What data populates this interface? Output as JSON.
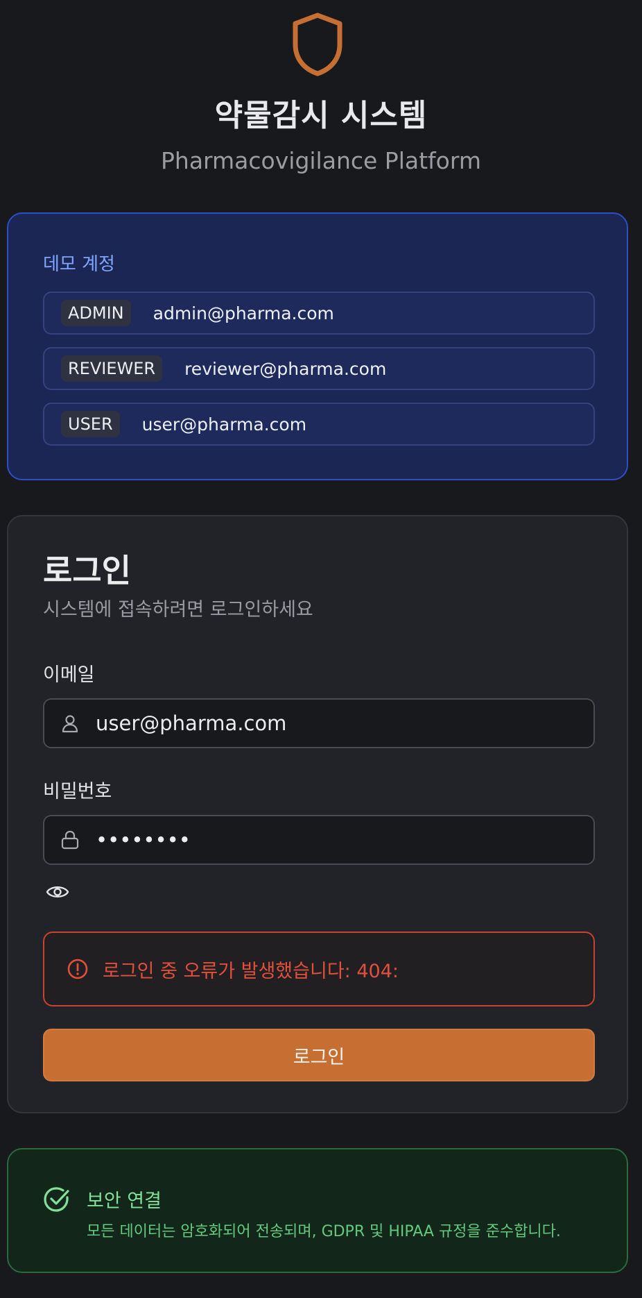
{
  "header": {
    "logo_icon": "shield-icon",
    "title": "약물감시 시스템",
    "subtitle": "Pharmacovigilance Platform"
  },
  "demo": {
    "title": "데모 계정",
    "accounts": [
      {
        "role": "ADMIN",
        "email": "admin@pharma.com"
      },
      {
        "role": "REVIEWER",
        "email": "reviewer@pharma.com"
      },
      {
        "role": "USER",
        "email": "user@pharma.com"
      }
    ]
  },
  "login": {
    "title": "로그인",
    "subtitle": "시스템에 접속하려면 로그인하세요",
    "email_label": "이메일",
    "email_value": "user@pharma.com",
    "email_icon": "user-icon",
    "password_label": "비밀번호",
    "password_value": "••••••••",
    "password_icon": "lock-icon",
    "toggle_icon": "eye-icon",
    "error_icon": "alert-circle-icon",
    "error_text": "로그인 중 오류가 발생했습니다: 404:",
    "button_label": "로그인"
  },
  "secure": {
    "icon": "check-circle-icon",
    "title": "보안 연결",
    "description": "모든 데이터는 암호화되어 전송되며, GDPR 및 HIPAA 규정을 준수합니다."
  },
  "colors": {
    "accent": "#c76f33",
    "error": "#e0503c",
    "success": "#82e09a",
    "demo_border": "#2f4dc4"
  }
}
